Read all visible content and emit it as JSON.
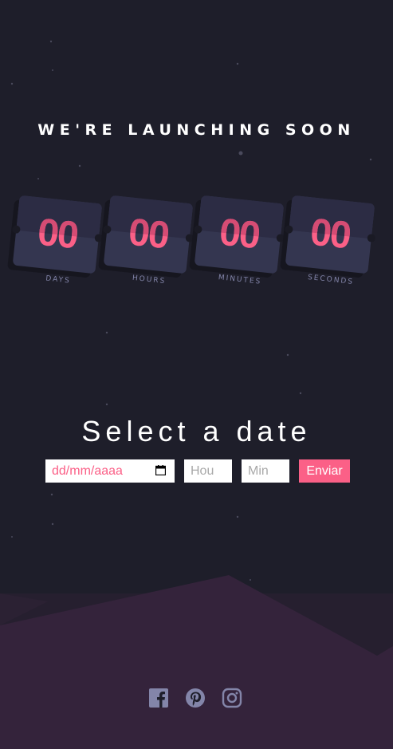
{
  "headline": "WE'RE LAUNCHING SOON",
  "countdown": [
    {
      "value": "00",
      "label": "DAYS"
    },
    {
      "value": "00",
      "label": "HOURS"
    },
    {
      "value": "00",
      "label": "MINUTES"
    },
    {
      "value": "00",
      "label": "SECONDS"
    }
  ],
  "date_section": {
    "title": "Select a date",
    "date_placeholder": "dd/mm/aaaa",
    "hour_placeholder": "Hou",
    "minute_placeholder": "Min",
    "submit_label": "Enviar"
  },
  "social": [
    "facebook-icon",
    "pinterest-icon",
    "instagram-icon"
  ],
  "colors": {
    "background": "#1e1e2a",
    "accent": "#fb6087",
    "card": "#343650",
    "label": "#8385a9",
    "hills": "#34233b",
    "icons": "#8385a9"
  }
}
